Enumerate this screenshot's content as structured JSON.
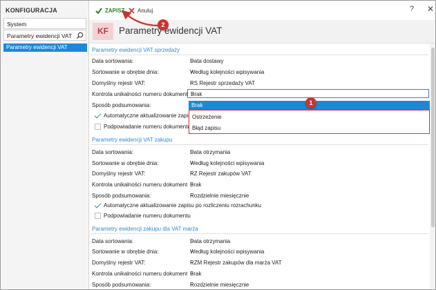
{
  "left": {
    "title": "KONFIGURACJA",
    "select_value": "System",
    "search_value": "Parametry ewidencji VAT",
    "items": [
      {
        "label": "Parametry ewidencji VAT"
      }
    ]
  },
  "toolbar": {
    "save_label": "ZAPISZ",
    "cancel_label": "Anuluj",
    "help": "?",
    "close": "✕"
  },
  "header": {
    "badge": "KF",
    "title": "Parametry ewidencji VAT"
  },
  "sections": [
    {
      "title": "Parametry ewidencji VAT sprzedaży",
      "fields": [
        {
          "label": "Data sortowania:",
          "value": "Data dostawy"
        },
        {
          "label": "Sortowanie w obrębie dnia:",
          "value": "Według kolejności wpisywania"
        },
        {
          "label": "Domyślny rejestr VAT:",
          "value": "RS   Rejestr sprzedaży VAT"
        },
        {
          "label": "Kontrola unikalności numeru dokumentu:",
          "value": "Brak"
        },
        {
          "label": "Sposób podsumowania:",
          "value": ""
        }
      ],
      "checks": [
        {
          "label": "Automatyczne aktualizowanie zapisu",
          "checked": true
        },
        {
          "label": "Podpowiadanie numeru dokumentu",
          "checked": false
        }
      ]
    },
    {
      "title": "Parametry ewidencji VAT zakupu",
      "fields": [
        {
          "label": "Data sortowania:",
          "value": "Data otrzymania"
        },
        {
          "label": "Sortowanie w obrębie dnia:",
          "value": "Według kolejności wpisywania"
        },
        {
          "label": "Domyślny rejestr VAT:",
          "value": "RZ   Rejestr zakupów VAT"
        },
        {
          "label": "Kontrola unikalności numeru dokumentu:",
          "value": "Brak"
        },
        {
          "label": "Sposób podsumowania:",
          "value": "Rozdzielnie miesięcznie"
        }
      ],
      "checks": [
        {
          "label": "Automatyczne aktualizowanie zapisu po rozliczeniu rozrachunku",
          "checked": true
        },
        {
          "label": "Podpowiadanie numeru dokumentu",
          "checked": false
        }
      ]
    },
    {
      "title": "Parametry ewidencji zakupu dla VAT marża",
      "fields": [
        {
          "label": "Data sortowania:",
          "value": "Data otrzymania"
        },
        {
          "label": "Sortowanie w obrębie dnia:",
          "value": "Według kolejności wpisywania"
        },
        {
          "label": "Domyślny rejestr VAT:",
          "value": "RZM   Rejestr zakupów dla marża VAT"
        },
        {
          "label": "Kontrola unikalności numeru dokumentu:",
          "value": "Brak"
        },
        {
          "label": "Sposób podsumowania:",
          "value": "Rozdzielnie miesięcznie"
        }
      ]
    }
  ],
  "dropdown": {
    "options": [
      "Brak",
      "Ostrzeżenie",
      "Błąd zapisu"
    ],
    "selected": "Brak"
  },
  "annotations": {
    "badge1": "1",
    "badge2": "2"
  },
  "colors": {
    "accent": "#1e88d6",
    "save": "#2d7d2d",
    "marker": "#c8362f"
  }
}
